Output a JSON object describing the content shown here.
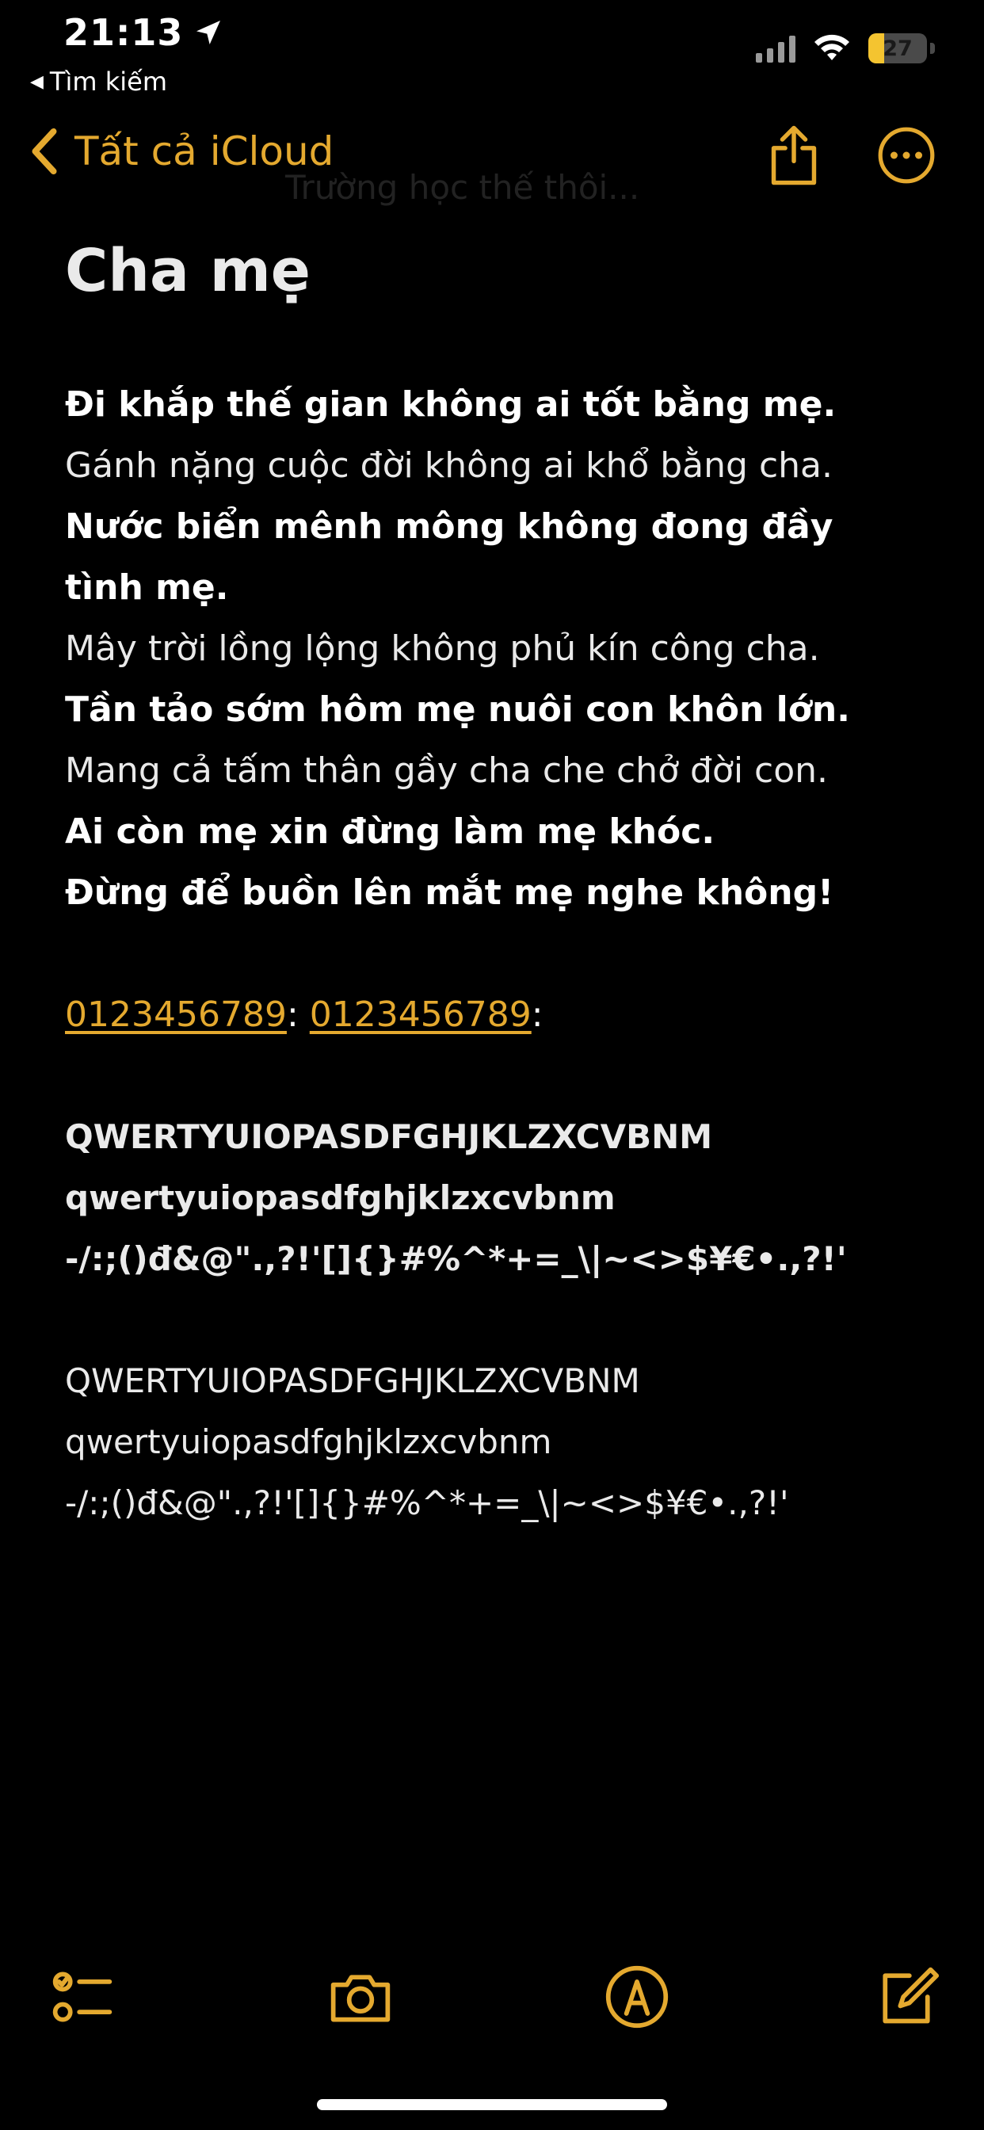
{
  "status_bar": {
    "time": "21:13",
    "back_app": "Tìm kiếm",
    "battery_level": "27",
    "battery_fraction": 0.27
  },
  "nav": {
    "back_label": "Tất cả iCloud",
    "ghost_text": "Trường học thế thôi...",
    "accent_color": "#e4a92f"
  },
  "note": {
    "title": "Cha mẹ",
    "poem": [
      "Đi khắp thế gian không ai tốt bằng mẹ.",
      "Gánh nặng cuộc đời không ai khổ bằng cha.",
      "Nước biển mênh mông không đong đầy tình mẹ.",
      "Mây trời lồng lộng không phủ kín công cha.",
      "Tần tảo sớm hôm mẹ nuôi con khôn lớn.",
      "Mang cả tấm thân gầy cha che chở đời con.",
      "Ai còn mẹ xin đừng làm mẹ khóc.",
      "Đừng để buồn lên mắt mẹ nghe không!"
    ],
    "phone_1": "0123456789",
    "phone_2": "0123456789",
    "separator": ":",
    "chars_bold": [
      "QWERTYUIOPASDFGHJKLZXCVBNM",
      "qwertyuiopasdfghjklzxcvbnm",
      "-/:;()đ&@\".,?!'[]{}#%^*+=_\\|~<>$¥€•.,?!'"
    ],
    "chars_light": [
      "QWERTYUIOPASDFGHJKLZXCVBNM",
      "qwertyuiopasdfghjklzxcvbnm",
      "-/:;()đ&@\".,?!'[]{}#%^*+=_\\|~<>$¥€•.,?!'"
    ]
  },
  "toolbar": {
    "icons": [
      "checklist-icon",
      "camera-icon",
      "markup-icon",
      "compose-icon"
    ]
  }
}
